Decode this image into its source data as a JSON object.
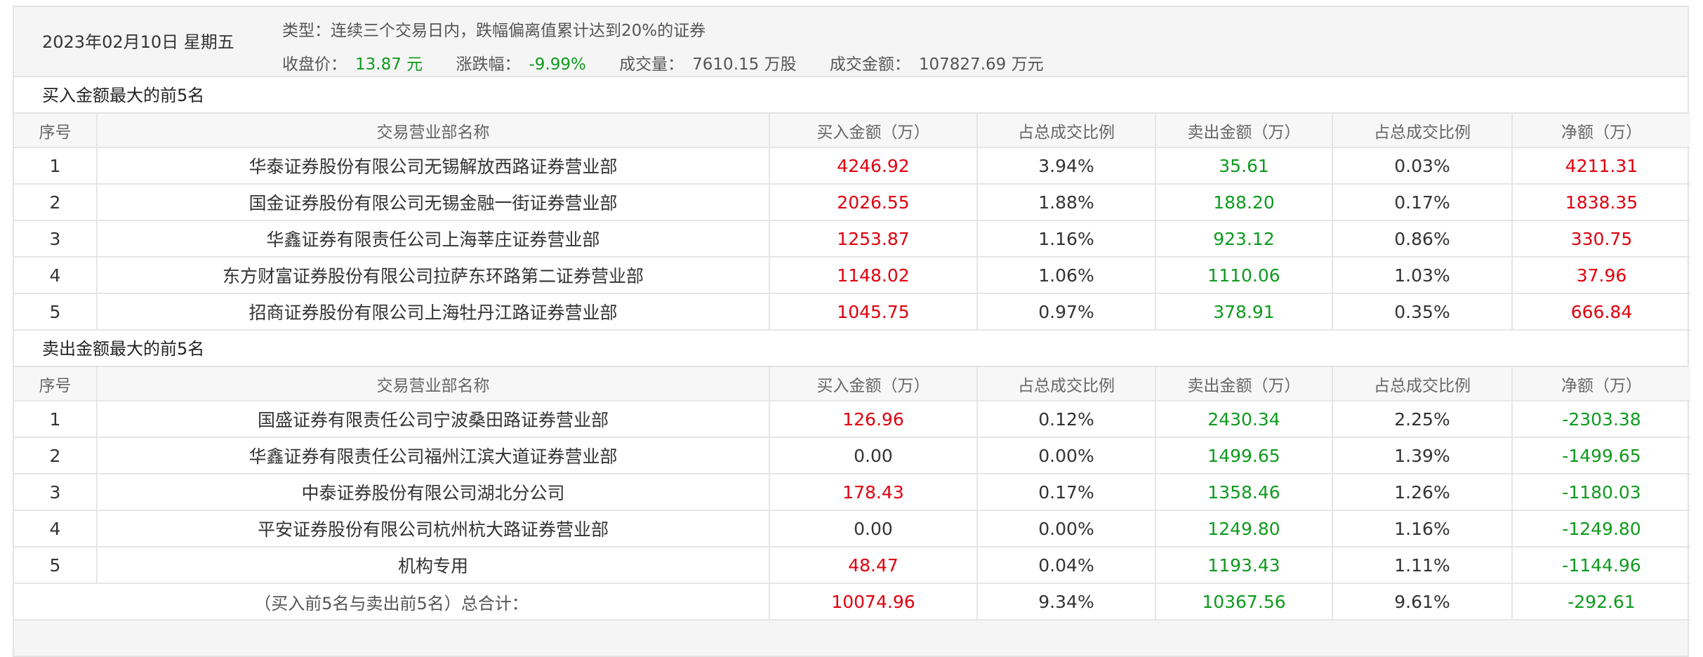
{
  "header": {
    "date": "2023年02月10日 星期五",
    "type_text": "类型：连续三个交易日内，跌幅偏离值累计达到20%的证券",
    "close_label": "收盘价：",
    "close_value": "13.87 元",
    "change_label": "涨跌幅：",
    "change_value": "-9.99%",
    "volume_label": "成交量：",
    "volume_value": "7610.15 万股",
    "amount_label": "成交金额：",
    "amount_value": "107827.69 万元"
  },
  "columns": [
    "序号",
    "交易营业部名称",
    "买入金额（万）",
    "占总成交比例",
    "卖出金额（万）",
    "占总成交比例",
    "净额（万）"
  ],
  "buy_section": {
    "title": "买入金额最大的前5名",
    "rows": [
      {
        "rank": "1",
        "name": "华泰证券股份有限公司无锡解放西路证券营业部",
        "buy": "4246.92",
        "buy_pct": "3.94%",
        "sell": "35.61",
        "sell_pct": "0.03%",
        "net": "4211.31"
      },
      {
        "rank": "2",
        "name": "国金证券股份有限公司无锡金融一街证券营业部",
        "buy": "2026.55",
        "buy_pct": "1.88%",
        "sell": "188.20",
        "sell_pct": "0.17%",
        "net": "1838.35"
      },
      {
        "rank": "3",
        "name": "华鑫证券有限责任公司上海莘庄证券营业部",
        "buy": "1253.87",
        "buy_pct": "1.16%",
        "sell": "923.12",
        "sell_pct": "0.86%",
        "net": "330.75"
      },
      {
        "rank": "4",
        "name": "东方财富证券股份有限公司拉萨东环路第二证券营业部",
        "buy": "1148.02",
        "buy_pct": "1.06%",
        "sell": "1110.06",
        "sell_pct": "1.03%",
        "net": "37.96"
      },
      {
        "rank": "5",
        "name": "招商证券股份有限公司上海牡丹江路证券营业部",
        "buy": "1045.75",
        "buy_pct": "0.97%",
        "sell": "378.91",
        "sell_pct": "0.35%",
        "net": "666.84"
      }
    ]
  },
  "sell_section": {
    "title": "卖出金额最大的前5名",
    "rows": [
      {
        "rank": "1",
        "name": "国盛证券有限责任公司宁波桑田路证券营业部",
        "buy": "126.96",
        "buy_pct": "0.12%",
        "sell": "2430.34",
        "sell_pct": "2.25%",
        "net": "-2303.38"
      },
      {
        "rank": "2",
        "name": "华鑫证券有限责任公司福州江滨大道证券营业部",
        "buy": "0.00",
        "buy_pct": "0.00%",
        "sell": "1499.65",
        "sell_pct": "1.39%",
        "net": "-1499.65"
      },
      {
        "rank": "3",
        "name": "中泰证券股份有限公司湖北分公司",
        "buy": "178.43",
        "buy_pct": "0.17%",
        "sell": "1358.46",
        "sell_pct": "1.26%",
        "net": "-1180.03"
      },
      {
        "rank": "4",
        "name": "平安证券股份有限公司杭州杭大路证券营业部",
        "buy": "0.00",
        "buy_pct": "0.00%",
        "sell": "1249.80",
        "sell_pct": "1.16%",
        "net": "-1249.80"
      },
      {
        "rank": "5",
        "name": "机构专用",
        "buy": "48.47",
        "buy_pct": "0.04%",
        "sell": "1193.43",
        "sell_pct": "1.11%",
        "net": "-1144.96"
      }
    ]
  },
  "total": {
    "label": "（买入前5名与卖出前5名）总合计：",
    "buy": "10074.96",
    "buy_pct": "9.34%",
    "sell": "10367.56",
    "sell_pct": "9.61%",
    "net": "-292.61"
  },
  "colors": {
    "up": "#e0000e",
    "down": "#0e9b1e"
  }
}
